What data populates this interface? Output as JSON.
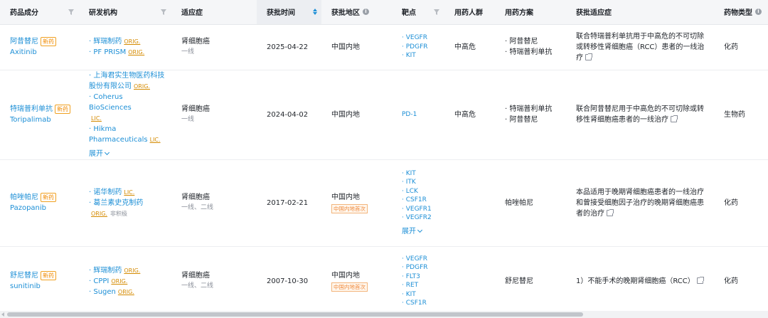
{
  "columns": [
    {
      "label": "药品成分",
      "icon": "filter-icon"
    },
    {
      "label": "研发机构",
      "icon": "filter-icon"
    },
    {
      "label": "适应症",
      "icon": ""
    },
    {
      "label": "获批时间",
      "icon": "sort-icon",
      "sorted": true
    },
    {
      "label": "获批地区",
      "icon": "info-icon"
    },
    {
      "label": "靶点",
      "icon": "filter-icon"
    },
    {
      "label": "用药人群",
      "icon": ""
    },
    {
      "label": "用药方案",
      "icon": ""
    },
    {
      "label": "获批适应症",
      "icon": ""
    },
    {
      "label": "药物类型",
      "icon": "info-icon"
    }
  ],
  "rows": [
    {
      "drug_cn": "阿昔替尼",
      "badge": "新药",
      "drug_en": "Axitinib",
      "orgs": [
        {
          "name": "辉瑞制药",
          "tag": "ORIG."
        },
        {
          "name": "PF PRISM",
          "tag": "ORIG."
        }
      ],
      "indication": "肾细胞癌",
      "line": "一线",
      "date": "2025-04-22",
      "region": "中国内地",
      "region_badge": "",
      "targets": [
        "VEGFR",
        "PDGFR",
        "KIT"
      ],
      "population": "中高危",
      "regimen": [
        "阿昔替尼",
        "特瑞普利单抗"
      ],
      "summary": "联合特瑞普利单抗用于中高危的不可切除或转移性肾细胞癌（RCC）患者的一线治疗",
      "drug_type": "化药"
    },
    {
      "drug_cn": "特瑞普利单抗",
      "badge": "新药",
      "drug_en": "Toripalimab",
      "orgs": [
        {
          "name": "上海君实生物医药科技股份有限公司",
          "tag": "ORIG."
        },
        {
          "name": "Coherus BioSciences",
          "tag": "LIC."
        },
        {
          "name": "Hikma Pharmaceuticals",
          "tag": "LIC."
        }
      ],
      "expand_label": "展开",
      "indication": "肾细胞癌",
      "line": "一线",
      "date": "2024-04-02",
      "region": "中国内地",
      "region_badge": "",
      "targets": [
        "PD-1"
      ],
      "population": "中高危",
      "regimen": [
        "特瑞普利单抗",
        "阿昔替尼"
      ],
      "summary": "联合阿昔替尼用于中高危的不可切除或转移性肾细胞癌患者的一线治疗",
      "drug_type": "生物药"
    },
    {
      "drug_cn": "帕唑帕尼",
      "badge": "新药",
      "drug_en": "Pazopanib",
      "orgs": [
        {
          "name": "诺华制药",
          "tag": "LIC."
        },
        {
          "name": "葛兰素史克制药",
          "tag": "ORIG.",
          "extra": "非积极"
        }
      ],
      "indication": "肾细胞癌",
      "line": "一线、二线",
      "date": "2017-02-21",
      "region": "中国内地",
      "region_badge": "中国内地首次",
      "targets": [
        "KIT",
        "ITK",
        "LCK",
        "CSF1R",
        "VEGFR1",
        "VEGFR2"
      ],
      "targets_expand": "展开",
      "population": "",
      "regimen": [
        "帕唑帕尼"
      ],
      "summary": "本品适用于晚期肾细胞癌患者的一线治疗和曾接受细胞因子治疗的晚期肾细胞癌患者的治疗",
      "drug_type": "化药"
    },
    {
      "drug_cn": "舒尼替尼",
      "badge": "新药",
      "drug_en": "sunitinib",
      "orgs": [
        {
          "name": "辉瑞制药",
          "tag": "ORIG."
        },
        {
          "name": "CPPI",
          "tag": "ORIG."
        },
        {
          "name": "Sugen",
          "tag": "ORIG."
        }
      ],
      "indication": "肾细胞癌",
      "line": "一线、二线",
      "date": "2007-10-30",
      "region": "中国内地",
      "region_badge": "中国内地首次",
      "targets": [
        "VEGFR",
        "PDGFR",
        "FLT3",
        "RET",
        "KIT",
        "CSF1R"
      ],
      "population": "",
      "regimen": [
        "舒尼替尼"
      ],
      "summary": "1）不能手术的晚期肾细胞癌（RCC）",
      "drug_type": "化药"
    }
  ],
  "colors": {
    "link": "#1d8fd6",
    "badge": "#f08a00",
    "header_bg": "#f5f6f8"
  }
}
